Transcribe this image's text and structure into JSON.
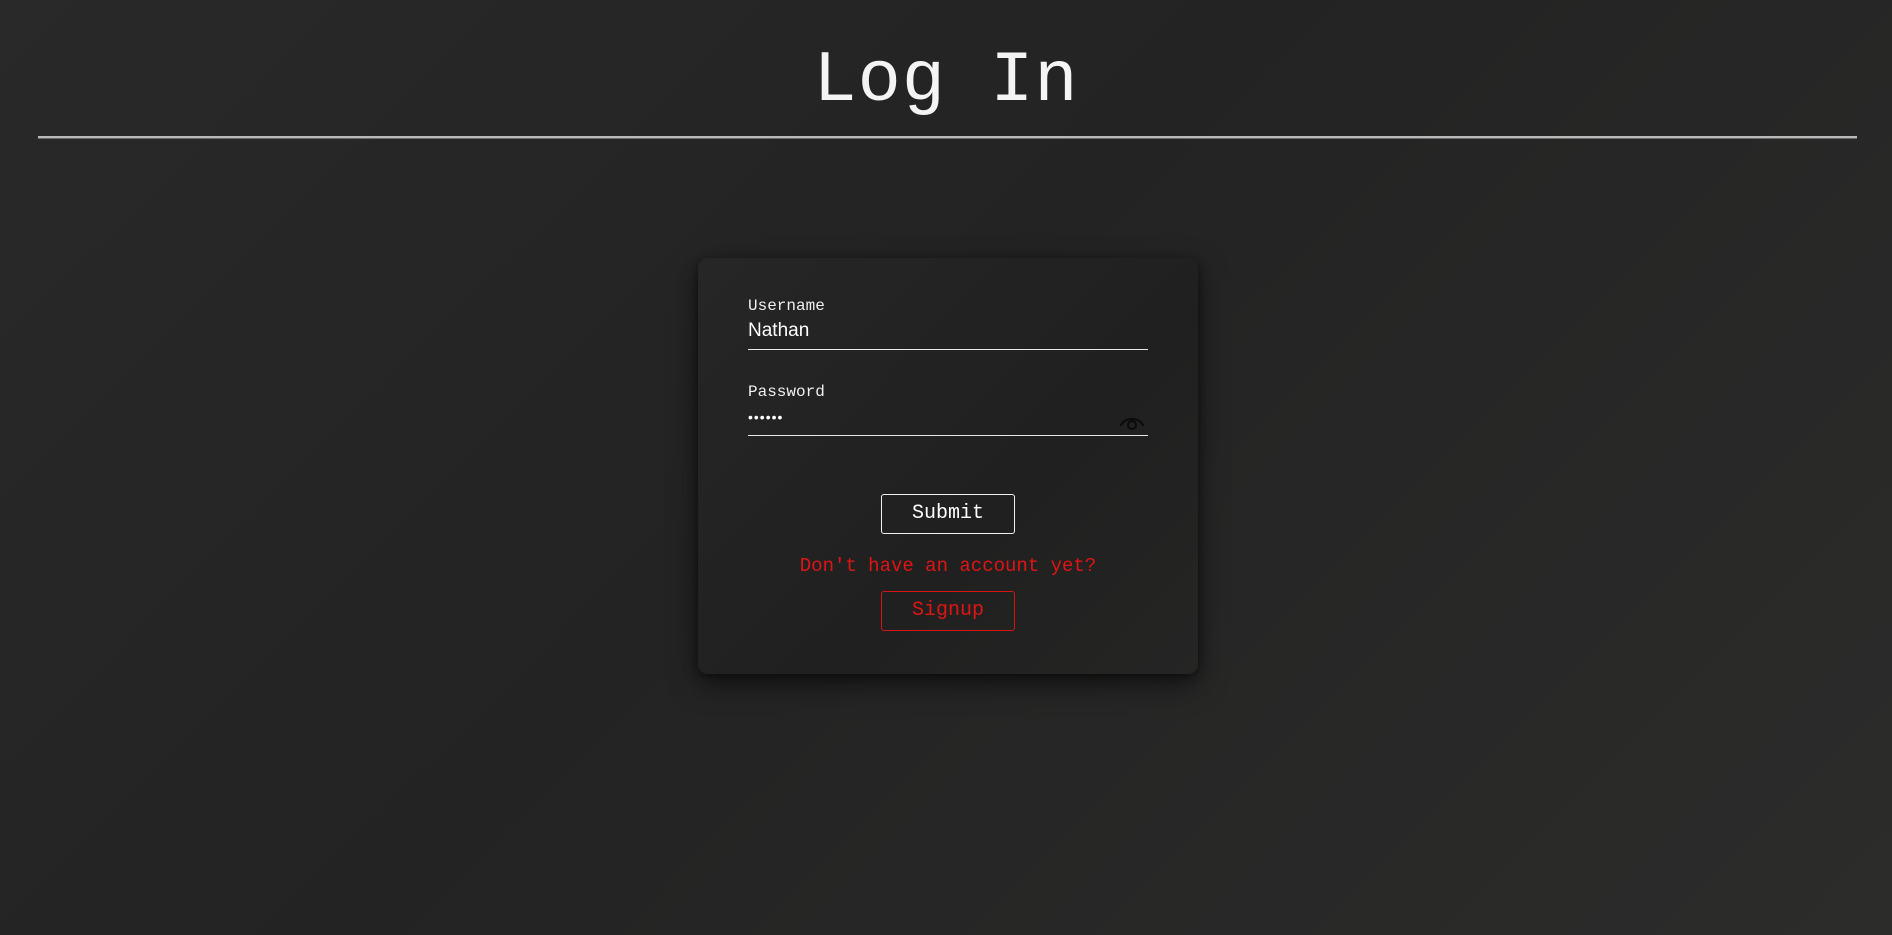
{
  "header": {
    "title": "Log In"
  },
  "form": {
    "username": {
      "label": "Username",
      "value": "Nathan"
    },
    "password": {
      "label": "Password",
      "value": "••••••",
      "toggle_icon": "eye-icon"
    },
    "submit_label": "Submit",
    "signup_prompt": "Don't have an account yet?",
    "signup_label": "Signup"
  },
  "colors": {
    "background": "#262626",
    "card": "#222222",
    "text": "#ffffff",
    "accent_red": "#e01414"
  }
}
